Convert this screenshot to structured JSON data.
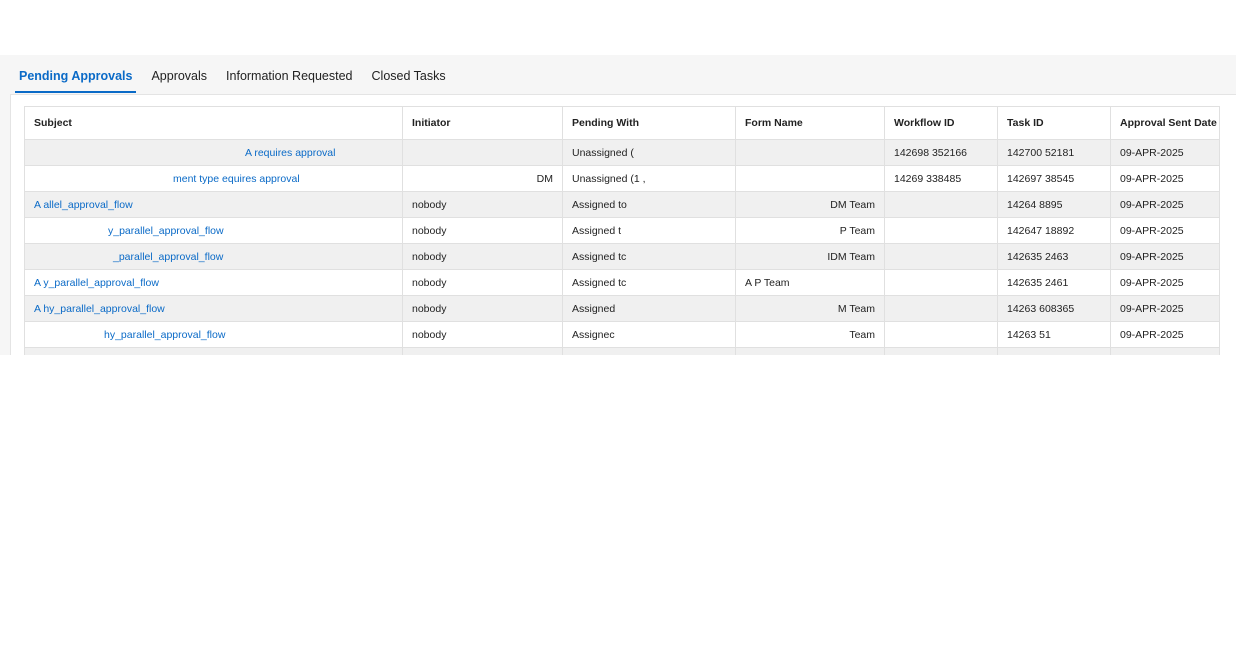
{
  "tabs": [
    "Pending Approvals",
    "Approvals",
    "Information Requested",
    "Closed Tasks"
  ],
  "active_tab": "Pending Approvals",
  "table": {
    "columns": [
      "Subject",
      "Initiator",
      "Pending With",
      "Form Name",
      "Workflow ID",
      "Task ID",
      "Approval Sent Date"
    ],
    "rows": [
      [
        "A requires approval",
        "",
        "Unassigned (",
        "",
        "142698 352166",
        "142700 52181",
        "09-APR-2025"
      ],
      [
        "ment type equires approval",
        "DM",
        "Unassigned (1 ,",
        "",
        "14269 338485",
        "142697 38545",
        "09-APR-2025"
      ],
      [
        "A allel_approval_flow",
        "nobody",
        "Assigned to",
        "DM Team",
        "",
        "14264 8895",
        "09-APR-2025"
      ],
      [
        "y_parallel_approval_flow",
        "nobody",
        "Assigned t",
        "P Team",
        "",
        "142647 18892",
        "09-APR-2025"
      ],
      [
        "_parallel_approval_flow",
        "nobody",
        "Assigned tc",
        "IDM Team",
        "",
        "142635 2463",
        "09-APR-2025"
      ],
      [
        "A y_parallel_approval_flow",
        "nobody",
        "Assigned tc",
        "A P Team",
        "",
        "142635 2461",
        "09-APR-2025"
      ],
      [
        "A hy_parallel_approval_flow",
        "nobody",
        "Assigned",
        "M Team",
        "",
        "14263 608365",
        "09-APR-2025"
      ],
      [
        "hy_parallel_approval_flow",
        "nobody",
        "Assignec",
        "Team",
        "",
        "14263 51",
        "09-APR-2025"
      ]
    ]
  }
}
